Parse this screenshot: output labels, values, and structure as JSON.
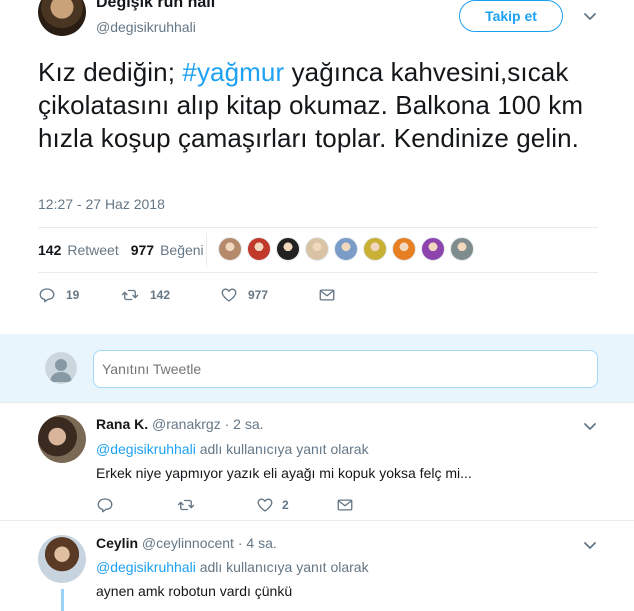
{
  "tweet": {
    "author_name": "Değişik ruh hali",
    "author_handle": "@degisikruhhali",
    "follow_label": "Takip et",
    "text_part1": "Kız dediğin; ",
    "hashtag": "#yağmur",
    "text_part2": " yağınca kahvesini,sıcak çikolatasını alıp kitap okumaz. Balkona 100 km hızla koşup çamaşırları toplar. Kendinize gelin.",
    "timestamp": "12:27 - 27 Haz 2018",
    "retweet_count": "142",
    "retweet_label": "Retweet",
    "like_count": "977",
    "like_label": "Beğeni",
    "actions": {
      "reply_count": "19",
      "retweet_count": "142",
      "like_count": "977"
    },
    "liker_colors": [
      "#b58a6a",
      "#c0392b",
      "#222222",
      "#d8c3a5",
      "#7a9cc6",
      "#c9b037",
      "#e67e22",
      "#8e44ad",
      "#7f8c8d"
    ]
  },
  "reply_box": {
    "placeholder": "Yanıtını Tweetle"
  },
  "replies": [
    {
      "name": "Rana K.",
      "handle": "@ranakrgz",
      "age": "· 2 sa.",
      "reply_to_mention": "@degisikruhhali",
      "reply_to_suffix": " adlı kullanıcıya yanıt olarak",
      "text": "Erkek niye yapmıyor yazık eli ayağı mi kopuk yoksa felç mi...",
      "like_count": "2"
    },
    {
      "name": "Ceylin",
      "handle": "@ceylinnocent",
      "age": "· 4 sa.",
      "reply_to_mention": "@degisikruhhali",
      "reply_to_suffix": " adlı kullanıcıya yanıt olarak",
      "text": "aynen amk robotun vardı çünkü"
    }
  ],
  "colors": {
    "accent": "#1da1f2",
    "muted": "#657786",
    "text": "#14171a",
    "reply_bg": "#e8f5fd"
  }
}
